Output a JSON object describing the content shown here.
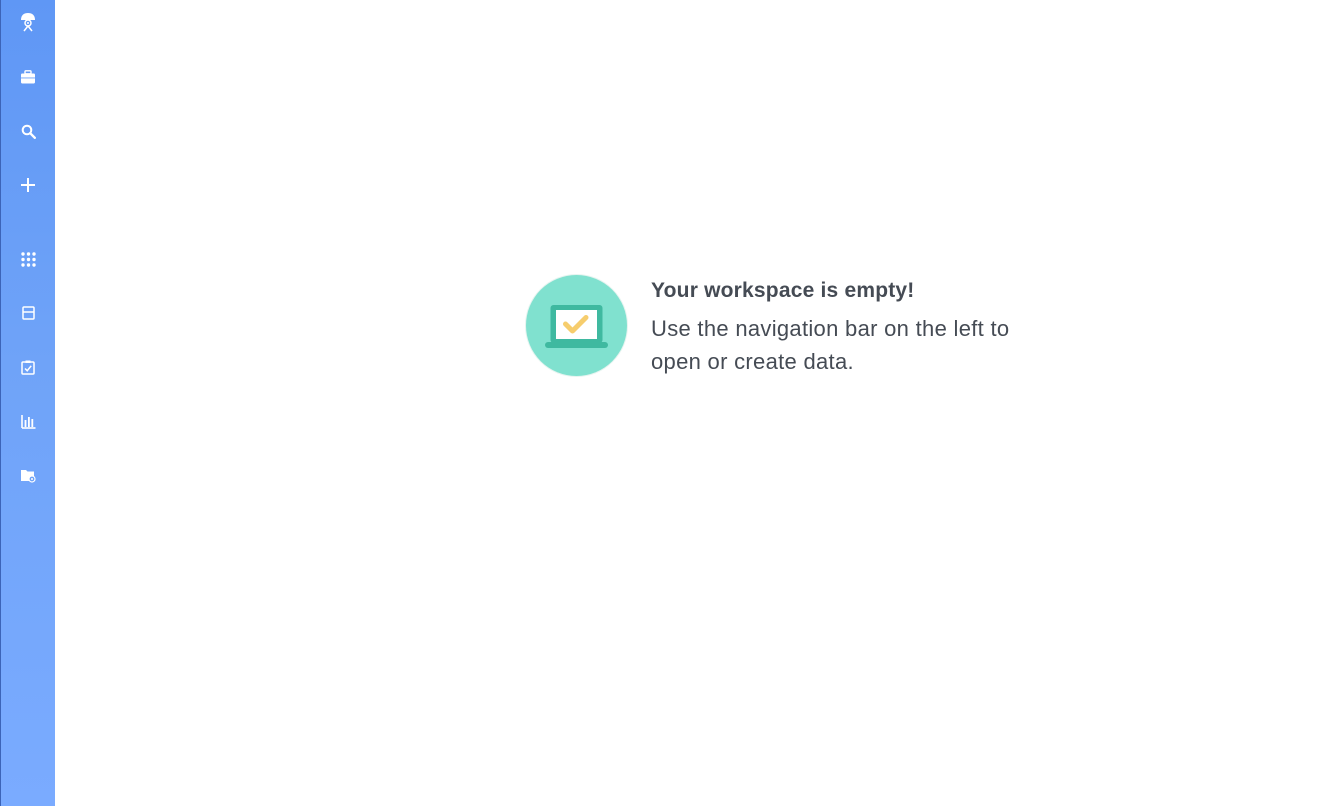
{
  "sidebar": {
    "items": [
      {
        "id": "logo",
        "icon": "user-logo-icon"
      },
      {
        "id": "workspace",
        "icon": "briefcase-icon"
      },
      {
        "id": "search",
        "icon": "search-icon"
      },
      {
        "id": "create",
        "icon": "plus-icon"
      },
      {
        "id": "apps",
        "icon": "grid-icon"
      },
      {
        "id": "archive",
        "icon": "archive-box-icon"
      },
      {
        "id": "tasks",
        "icon": "clipboard-check-icon"
      },
      {
        "id": "reports",
        "icon": "bar-chart-icon"
      },
      {
        "id": "shared",
        "icon": "folder-settings-icon"
      }
    ]
  },
  "main": {
    "empty_state": {
      "illustration": "laptop-check-icon",
      "title": "Your workspace is empty!",
      "message": "Use the navigation bar on the left to open or create data."
    }
  },
  "colors": {
    "sidebar": "#6fa3f8",
    "illustration_bg": "#80e1cf",
    "laptop": "#3fb9a0",
    "check": "#f6cd6d",
    "text": "#454b54"
  }
}
